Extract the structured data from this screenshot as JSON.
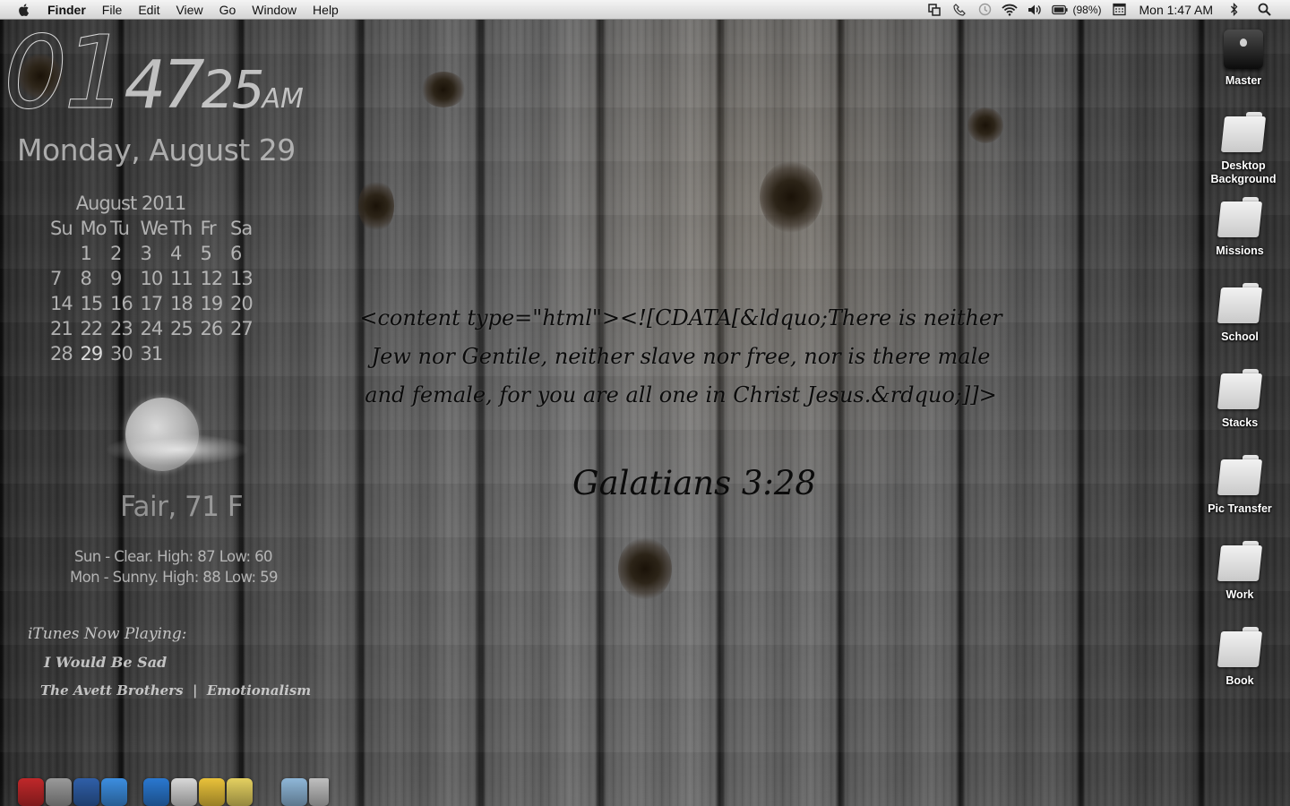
{
  "menubar": {
    "app_name": "Finder",
    "menus": [
      "File",
      "Edit",
      "View",
      "Go",
      "Window",
      "Help"
    ],
    "battery": "(98%)",
    "clock": "Mon 1:47 AM"
  },
  "clock_widget": {
    "hour": "01",
    "minute": "47",
    "second": "25",
    "ampm": "AM",
    "date": "Monday, August 29"
  },
  "calendar": {
    "title": "August 2011",
    "weekdays": [
      "Su",
      "Mo",
      "Tu",
      "We",
      "Th",
      "Fr",
      "Sa"
    ],
    "weeks": [
      [
        "",
        "1",
        "2",
        "3",
        "4",
        "5",
        "6"
      ],
      [
        "7",
        "8",
        "9",
        "10",
        "11",
        "12",
        "13"
      ],
      [
        "14",
        "15",
        "16",
        "17",
        "18",
        "19",
        "20"
      ],
      [
        "21",
        "22",
        "23",
        "24",
        "25",
        "26",
        "27"
      ],
      [
        "28",
        "29",
        "30",
        "31",
        "",
        "",
        ""
      ]
    ]
  },
  "weather": {
    "current": "Fair, 71 F",
    "forecast": [
      "Sun - Clear. High: 87 Low: 60",
      "Mon - Sunny. High: 88 Low: 59"
    ]
  },
  "itunes": {
    "label": "iTunes Now Playing:",
    "track": "I Would Be Sad",
    "artist_album": "The Avett Brothers  |  Emotionalism"
  },
  "verse": {
    "text": "<content type=\"html\"><![CDATA[&ldquo;There is neither Jew nor Gentile, neither slave nor free, nor is there male and female, for you are all one in Christ Jesus.&rdquo;]]>",
    "reference": "Galatians 3:28"
  },
  "desktop_icons": [
    {
      "label": "Master",
      "icon": "hard-drive-icon"
    },
    {
      "label": "Desktop Background",
      "icon": "folder-icon"
    },
    {
      "label": "Missions",
      "icon": "folder-icon"
    },
    {
      "label": "School",
      "icon": "folder-icon"
    },
    {
      "label": "Stacks",
      "icon": "folder-icon"
    },
    {
      "label": "Pic Transfer",
      "icon": "folder-icon"
    },
    {
      "label": "Work",
      "icon": "folder-icon"
    },
    {
      "label": "Book",
      "icon": "folder-icon"
    }
  ],
  "dock": {
    "items": [
      {
        "name": "photo-booth-icon",
        "color": "#c0282a"
      },
      {
        "name": "disk-utility-icon",
        "color": "#9a9a9a"
      },
      {
        "name": "network-globe-icon",
        "color": "#2f5fa8"
      },
      {
        "name": "itunes-icon",
        "color": "#3c8ee0"
      },
      {
        "name": "app-store-icon",
        "color": "#2a78d0"
      },
      {
        "name": "preview-icon",
        "color": "#d8d8d8"
      },
      {
        "name": "mail-icon",
        "color": "#e9c23a"
      },
      {
        "name": "pages-icon",
        "color": "#e4d060"
      },
      {
        "name": "documents-stack-icon",
        "color": "#8fb7d8"
      },
      {
        "name": "trash-icon",
        "color": "#bfbfbf"
      }
    ]
  }
}
